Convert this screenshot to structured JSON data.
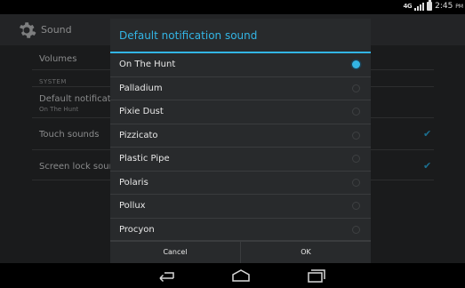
{
  "statusbar": {
    "network": "4G",
    "time": "2:45",
    "ampm": "PM"
  },
  "actionbar": {
    "title": "Sound"
  },
  "settings": {
    "volumes": "Volumes",
    "system_header": "SYSTEM",
    "default_notification": "Default notification",
    "default_notification_summary": "On The Hunt",
    "touch_sounds": "Touch sounds",
    "screen_lock_sound": "Screen lock sound"
  },
  "dialog": {
    "title": "Default notification sound",
    "accent": "#33b5e5",
    "selected_index": 0,
    "options": [
      {
        "label": "On The Hunt"
      },
      {
        "label": "Palladium"
      },
      {
        "label": "Pixie Dust"
      },
      {
        "label": "Pizzicato"
      },
      {
        "label": "Plastic Pipe"
      },
      {
        "label": "Polaris"
      },
      {
        "label": "Pollux"
      },
      {
        "label": "Procyon"
      }
    ],
    "cancel_label": "Cancel",
    "ok_label": "OK"
  },
  "navbar": {
    "back": "back-icon",
    "home": "home-icon",
    "recents": "recents-icon"
  }
}
